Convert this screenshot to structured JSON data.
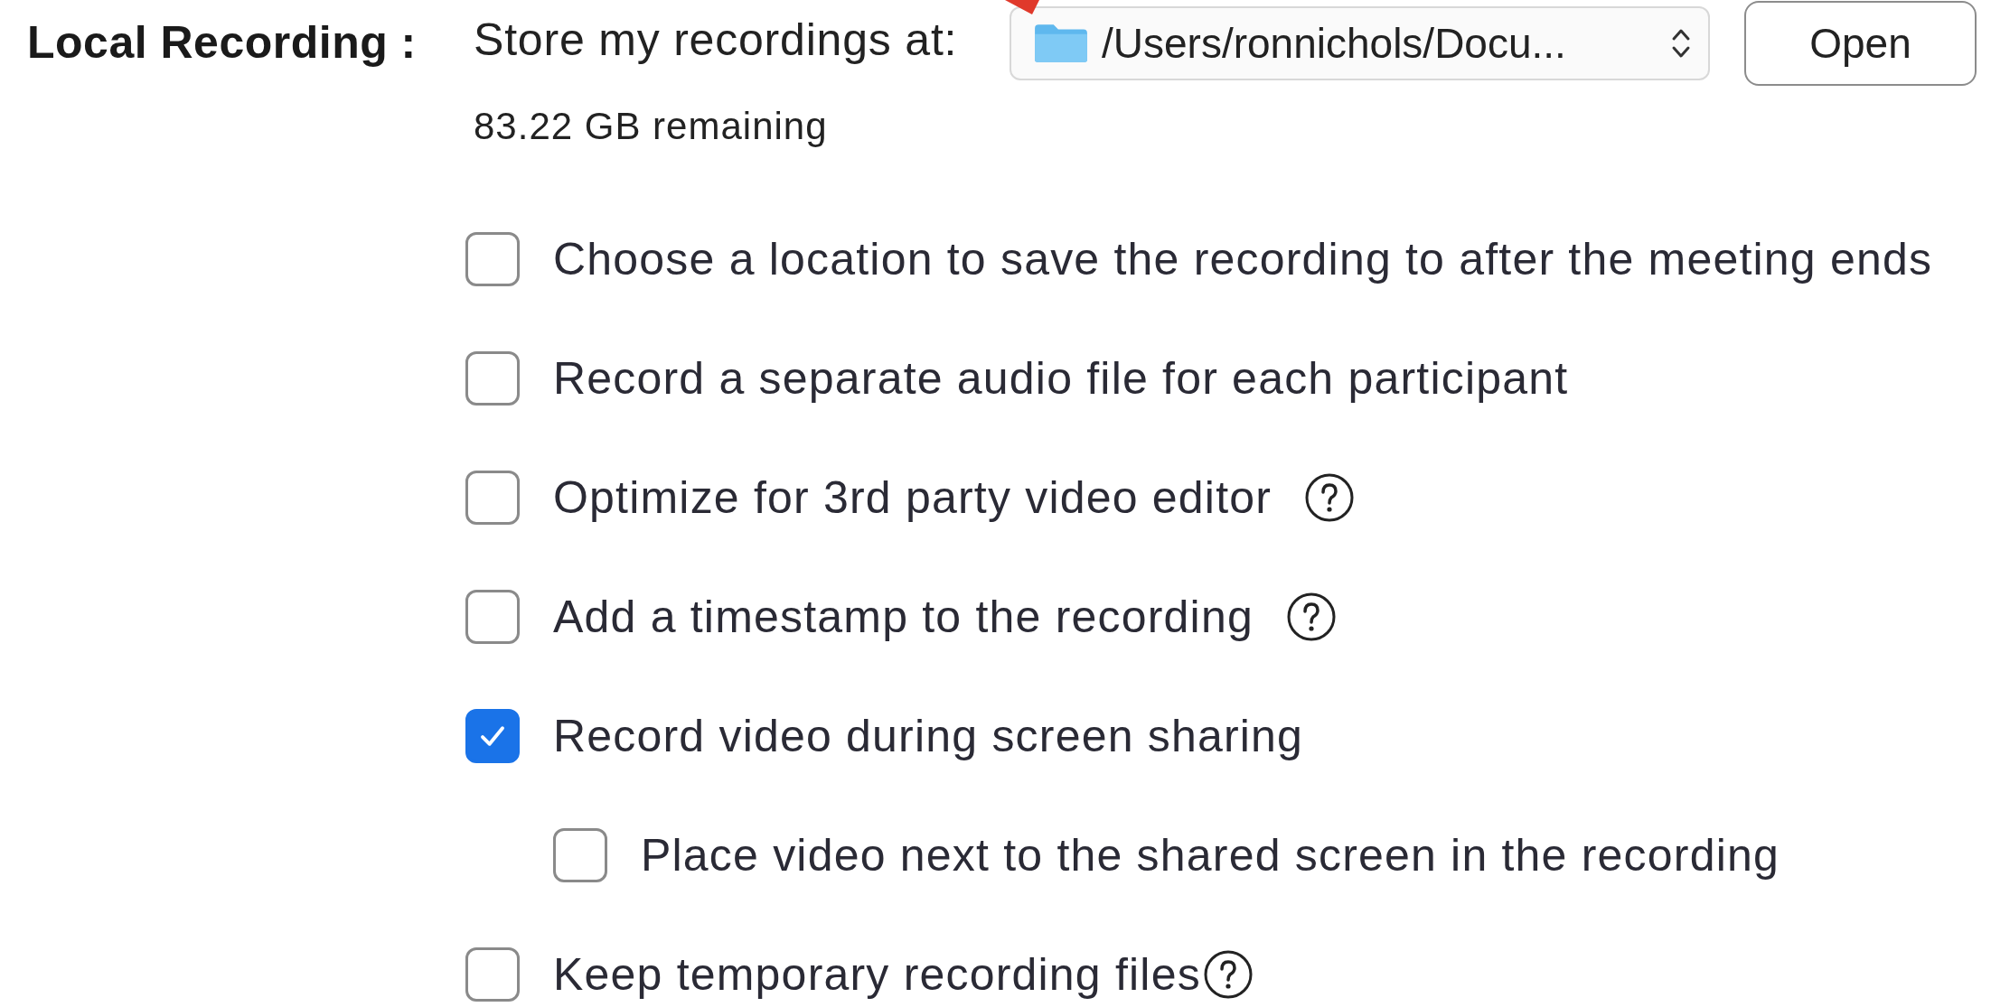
{
  "section_label": "Local Recording :",
  "storage": {
    "label": "Store my recordings at:",
    "path": "/Users/ronnichols/Docu...",
    "button": "Open",
    "remaining": "83.22 GB remaining"
  },
  "options": [
    {
      "label": "Choose a location to save the recording to after the meeting ends",
      "checked": false
    },
    {
      "label": "Record a separate audio file for each participant",
      "checked": false
    },
    {
      "label": "Optimize for 3rd party video editor",
      "checked": false,
      "help": true
    },
    {
      "label": "Add a timestamp to the recording",
      "checked": false,
      "help": true
    },
    {
      "label": "Record video during screen sharing",
      "checked": true,
      "children": [
        {
          "label": "Place video next to the shared screen in the recording",
          "checked": false
        }
      ]
    },
    {
      "label": "Keep temporary recording files",
      "checked": false,
      "help": true
    }
  ]
}
